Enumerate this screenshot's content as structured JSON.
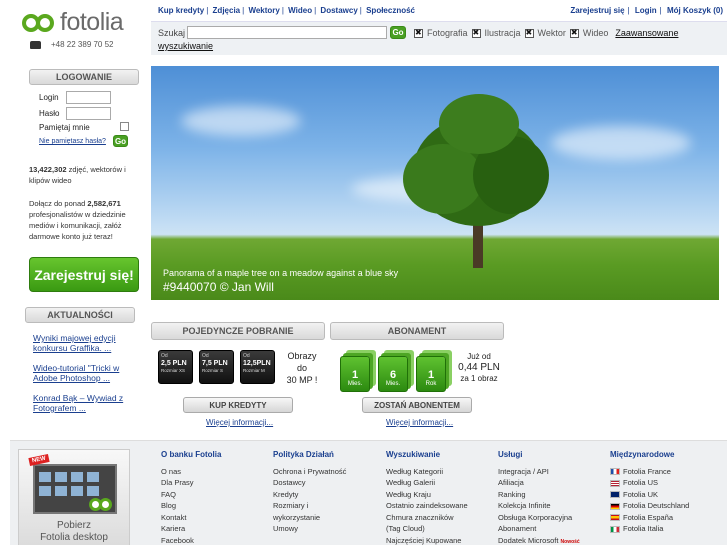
{
  "header": {
    "logo_text": "fotolia",
    "phone": "+48 22 389 70 52",
    "nav": [
      "Kup kredyty",
      "Zdjęcia",
      "Wektory",
      "Wideo",
      "Dostawcy",
      "Społeczność"
    ],
    "account": [
      "Zarejestruj się",
      "Login",
      "Mój Koszyk (0)"
    ]
  },
  "search": {
    "label": "Szukaj",
    "value": "",
    "go": "Go",
    "filters": [
      "Fotografia",
      "Ilustracja",
      "Wektor",
      "Wideo"
    ],
    "advanced_a": "Zaawansowane",
    "advanced_b": "wyszukiwanie"
  },
  "login": {
    "heading": "LOGOWANIE",
    "login_label": "Login",
    "password_label": "Hasło",
    "remember_label": "Pamiętaj mnie",
    "forgot": "Nie pamiętasz hasła?",
    "go": "Go"
  },
  "stats": {
    "images_count": "13,422,302",
    "images_text": "zdjęć, wektorów i klipów wideo",
    "join_a": "Dołącz do ponad",
    "pros_count": "2,582,671",
    "join_b": "profesjonalistów w dziedzinie mediów i komunikacji, załóż darmowe konto już teraz!"
  },
  "register_button": "Zarejestruj się!",
  "news": {
    "heading": "AKTUALNOŚCI",
    "items": [
      "Wyniki majowej edycji konkursu Graffika. ...",
      "Wideo-tutorial \"Tricki w Adobe Photoshop ...",
      "Konrad Bąk – Wywiad z Fotografem ..."
    ]
  },
  "hero": {
    "caption": "Panorama of a maple tree on a meadow against a blue sky",
    "id_line": "#9440070  © Jan Will"
  },
  "single": {
    "heading": "POJEDYNCZE POBRANIE",
    "packs": [
      {
        "od": "Od",
        "price": "2,5 PLN",
        "size": "Rozmiar XS"
      },
      {
        "od": "Od",
        "price": "7,5 PLN",
        "size": "Rozmiar S"
      },
      {
        "od": "Od",
        "price": "12,5PLN",
        "size": "Rozmiar M"
      }
    ],
    "up_to_a": "Obrazy",
    "up_to_b": "do",
    "up_to_c": "30 MP !",
    "button": "KUP KREDYTY",
    "more": "Więcej informacji..."
  },
  "subscription": {
    "heading": "ABONAMENT",
    "packs": [
      {
        "n": "1",
        "u": "Mies."
      },
      {
        "n": "6",
        "u": "Mies."
      },
      {
        "n": "1",
        "u": "Rok"
      }
    ],
    "price_a": "Już od",
    "price_b": "0,44 PLN",
    "price_c": "za 1 obraz",
    "button": "ZOSTAŃ ABONENTEM",
    "more": "Więcej informacji..."
  },
  "footer": {
    "promo_badge": "NEW",
    "promo_a": "Pobierz",
    "promo_b": "Fotolia desktop",
    "columns": [
      {
        "heading": "O banku Fotolia",
        "items": [
          "O nas",
          "Dla Prasy",
          "FAQ",
          "Blog",
          "Kontakt",
          "Kariera",
          "Facebook"
        ]
      },
      {
        "heading": "Polityka Działań",
        "items": [
          "Ochrona i Prywatność",
          "Dostawcy",
          "Kredyty",
          "Rozmiary i",
          "wykorzystanie",
          "Umowy"
        ]
      },
      {
        "heading": "Wyszukiwanie",
        "items": [
          "Według Kategorii",
          "Według Galerii",
          "Według Kraju",
          "Ostatnio zaindeksowane",
          "Chmura znaczników",
          "(Tag Cloud)",
          "Najczęściej Kupowane"
        ]
      },
      {
        "heading": "Usługi",
        "items": [
          "Integracja / API",
          "Afiliacja",
          "Ranking",
          "Kolekcja Infinite",
          "Obsługa Korporacyjna",
          "Abonament",
          "Dodatek Microsoft"
        ]
      },
      {
        "heading": "Międzynarodowe",
        "items": [
          "Fotolia France",
          "Fotolia US",
          "Fotolia UK",
          "Fotolia Deutschland",
          "Fotolia España",
          "Fotolia Italia"
        ]
      }
    ],
    "new_tag": "Nowość",
    "flag_colors": [
      "#1f4fa8",
      "#b22234",
      "#012169",
      "#000000",
      "#c60b1e",
      "#009246"
    ]
  },
  "colors": {
    "brand_green": "#5aa81e",
    "link_blue": "#1a3f8f"
  }
}
